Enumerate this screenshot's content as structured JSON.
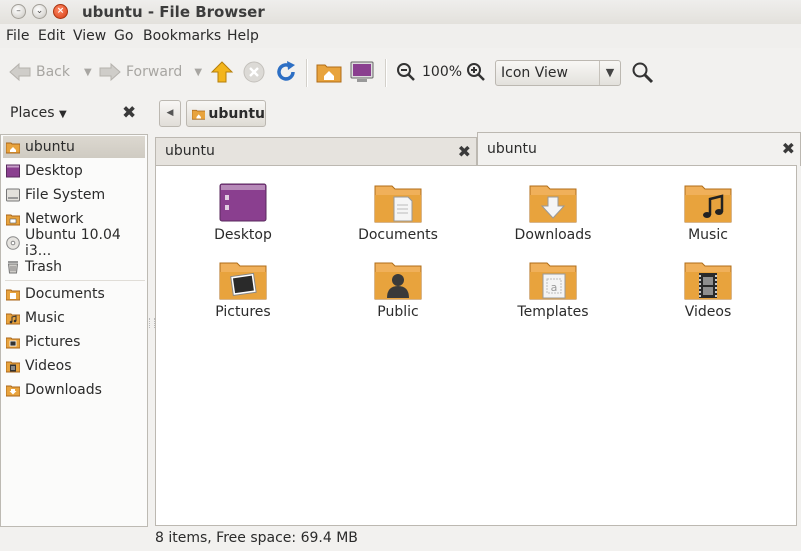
{
  "window": {
    "title": "ubuntu - File Browser"
  },
  "menu": [
    "File",
    "Edit",
    "View",
    "Go",
    "Bookmarks",
    "Help"
  ],
  "toolbar": {
    "back_label": "Back",
    "forward_label": "Forward",
    "zoom_level": "100%",
    "view_mode": "Icon View"
  },
  "sidebar": {
    "header": "Places",
    "places": [
      {
        "label": "ubuntu",
        "icon": "home-folder-icon",
        "selected": true
      },
      {
        "label": "Desktop",
        "icon": "desktop-icon"
      },
      {
        "label": "File System",
        "icon": "filesystem-icon"
      },
      {
        "label": "Network",
        "icon": "network-icon"
      },
      {
        "label": "Ubuntu 10.04 i3...",
        "icon": "cdrom-icon"
      },
      {
        "label": "Trash",
        "icon": "trash-icon"
      }
    ],
    "bookmarks": [
      {
        "label": "Documents",
        "icon": "documents-folder-icon"
      },
      {
        "label": "Music",
        "icon": "music-folder-icon"
      },
      {
        "label": "Pictures",
        "icon": "pictures-folder-icon"
      },
      {
        "label": "Videos",
        "icon": "videos-folder-icon"
      },
      {
        "label": "Downloads",
        "icon": "downloads-folder-icon"
      }
    ]
  },
  "path": {
    "current": "ubuntu"
  },
  "tabs": [
    {
      "label": "ubuntu",
      "active": false
    },
    {
      "label": "ubuntu",
      "active": true
    }
  ],
  "files": [
    {
      "label": "Desktop",
      "icon": "desktop-icon"
    },
    {
      "label": "Documents",
      "icon": "documents-folder-icon"
    },
    {
      "label": "Downloads",
      "icon": "downloads-folder-icon"
    },
    {
      "label": "Music",
      "icon": "music-folder-icon"
    },
    {
      "label": "Pictures",
      "icon": "pictures-folder-icon"
    },
    {
      "label": "Public",
      "icon": "public-folder-icon"
    },
    {
      "label": "Templates",
      "icon": "templates-folder-icon"
    },
    {
      "label": "Videos",
      "icon": "videos-folder-icon"
    }
  ],
  "status": "8 items, Free space: 69.4 MB",
  "colors": {
    "folder": "#e8a33d",
    "desktop": "#8a3f8f",
    "selection": "#d6d2ca"
  }
}
